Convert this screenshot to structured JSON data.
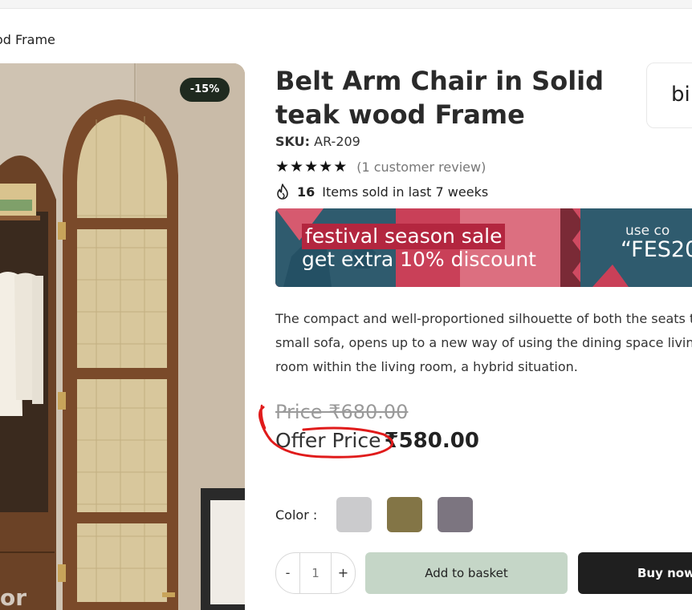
{
  "breadcrumb": {
    "current": "od Frame"
  },
  "product": {
    "discount_badge": "-15%",
    "title": "Belt Arm Chair in Solid teak wood Frame",
    "brand_partial": "bi",
    "sku_label": "SKU:",
    "sku_value": "AR-209",
    "rating_stars": 5,
    "review_text": "(1 customer review)",
    "sold_count": "16",
    "sold_text": "Items sold in last 7 weeks",
    "description": "The compact and well-proportioned silhouette of both the seats the small sofa, opens up to a new way of using the dining space living room within the living room, a hybrid situation.",
    "old_price": "Price ₹680.00",
    "offer_label": "Offer Price",
    "offer_value": "₹580.00",
    "image_watermark": "or"
  },
  "banner": {
    "line1": "festival season sale",
    "line2": "get extra 10% discount",
    "code_label": "use co",
    "code": "“FES20"
  },
  "colors": {
    "label": "Color :",
    "swatches": [
      "#cbcbcd",
      "#837546",
      "#7c7580"
    ]
  },
  "purchase": {
    "minus": "-",
    "quantity": "1",
    "plus": "+",
    "add_to_basket": "Add to basket",
    "buy_now": "Buy now"
  },
  "icons": {
    "star": "star-icon",
    "fire": "fire-icon"
  }
}
